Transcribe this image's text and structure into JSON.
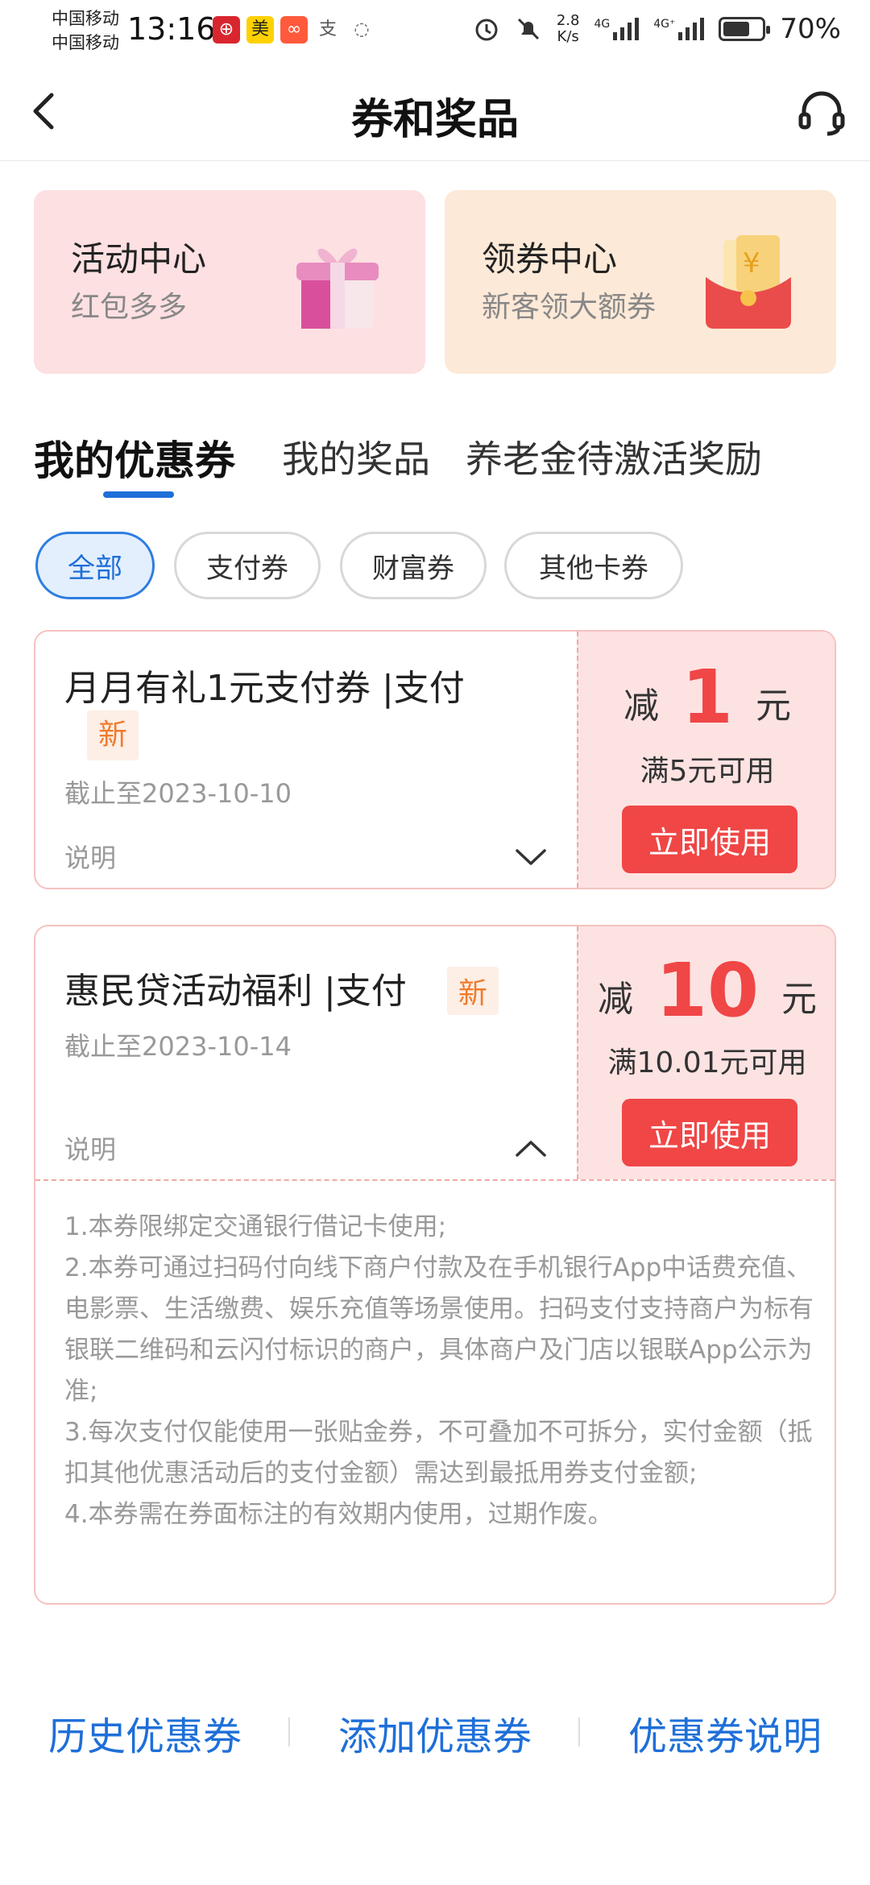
{
  "status_bar": {
    "carrier1": "中国移动",
    "carrier2": "中国移动",
    "time": "13:16",
    "net_speed": "2.8",
    "net_unit": "K/s",
    "signal1": "4G",
    "signal2": "4G⁺",
    "battery": "70%",
    "battery_level": 0.7
  },
  "header": {
    "title": "券和奖品"
  },
  "promo": [
    {
      "title": "活动中心",
      "subtitle": "红包多多",
      "icon": "gift-box-icon"
    },
    {
      "title": "领券中心",
      "subtitle": "新客领大额券",
      "icon": "red-envelope-icon"
    }
  ],
  "tabs": [
    {
      "label": "我的优惠券",
      "active": true
    },
    {
      "label": "我的奖品",
      "active": false
    },
    {
      "label": "养老金待激活奖励",
      "active": false
    }
  ],
  "filters": [
    {
      "label": "全部",
      "active": true
    },
    {
      "label": "支付券",
      "active": false
    },
    {
      "label": "财富券",
      "active": false
    },
    {
      "label": "其他卡券",
      "active": false
    }
  ],
  "coupons": [
    {
      "name": "月月有礼1元支付券 |支付",
      "badge": "新",
      "expiry": "截止至2023-10-10",
      "desc_label": "说明",
      "prefix": "减",
      "amount": "1",
      "unit": "元",
      "condition": "满5元可用",
      "button": "立即使用"
    },
    {
      "name": "惠民贷活动福利 |支付",
      "badge": "新",
      "expiry": "截止至2023-10-14",
      "desc_label": "说明",
      "prefix": "减",
      "amount": "10",
      "unit": "元",
      "condition": "满10.01元可用",
      "button": "立即使用",
      "rules": [
        "1.本券限绑定交通银行借记卡使用;",
        "2.本券可通过扫码付向线下商户付款及在手机银行App中话费充值、电影票、生活缴费、娱乐充值等场景使用。扫码支付支持商户为标有银联二维码和云闪付标识的商户，具体商户及门店以银联App公示为准;",
        "3.每次支付仅能使用一张贴金券，不可叠加不可拆分，实付金额（抵扣其他优惠活动后的支付金额）需达到最抵用券支付金额;",
        "4.本券需在券面标注的有效期内使用，过期作废。"
      ]
    }
  ],
  "footer": {
    "history": "历史优惠券",
    "add": "添加优惠券",
    "explain": "优惠券说明"
  },
  "colors": {
    "accent": "#1e6fd8",
    "coupon_red": "#f04646",
    "new_badge": "#ef7b2c"
  }
}
